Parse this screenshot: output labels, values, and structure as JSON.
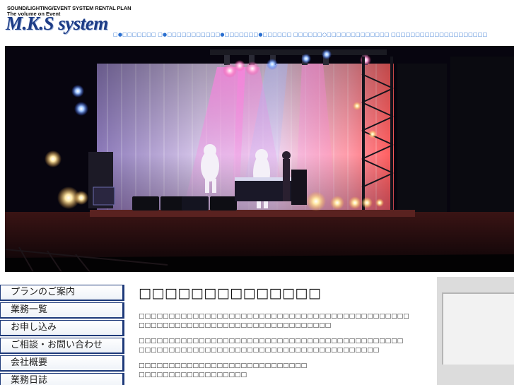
{
  "header": {
    "tagline": "SOUND/LIGHTING/EVENT SYSTEM RENTAL PLAN",
    "subtitle": "The volume on Event",
    "logo": "M.K.S system"
  },
  "top_nav": {
    "text": "□●□□□□□□□ □●□□□□□□□□□□□●□□□□□□□●□□□□□□ □□□□□□○□□□□□□□□□□□□□ □□□□□□□□□□□□□□□□□□□□"
  },
  "hero": {
    "description_icon": "stage-lighting-photo-icon"
  },
  "side_menu": {
    "items": [
      {
        "label": "プランのご案内"
      },
      {
        "label": "業務一覧"
      },
      {
        "label": "お申し込み"
      },
      {
        "label": "ご相談・お問い合わせ"
      },
      {
        "label": "会社概要"
      },
      {
        "label": "業務日誌"
      }
    ]
  },
  "main": {
    "heading": "□□□□□□□□□□□□□□",
    "paragraphs": [
      "□□□□□□□□□□□□□□□□□□□□□□□□□□□□□□□□□□□□□□□□□□□□□\n□□□□□□□□□□□□□□□□□□□□□□□□□□□□□□□□",
      "□□□□□□□□□□□□□□□□□□□□□□□□□□□□□□□□□□□□□□□□□□□□\n□□□□□□□□□□□□□□□□□□□□□□□□□□□□□□□□□□□□□□□□",
      "□□□□□□□□□□□□□□□□□□□□□□□□□□□□\n□□□□□□□□□□□□□□□□□□"
    ]
  },
  "colors": {
    "logo": "#1d3c86",
    "nav_link": "#2a6fd0",
    "menu_border": "#1e3a7a"
  }
}
